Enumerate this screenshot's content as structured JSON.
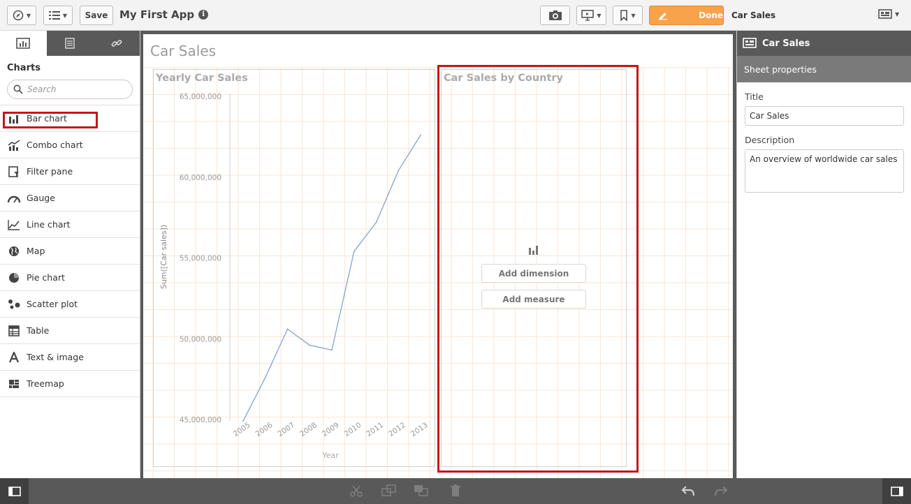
{
  "toolbar": {
    "save_label": "Save",
    "app_title": "My First App",
    "info_glyph": "i",
    "done_label": "Done",
    "sheet_name": "Car Sales"
  },
  "left_panel": {
    "heading": "Charts",
    "search_placeholder": "Search",
    "items": [
      {
        "label": "Bar chart",
        "icon": "bar-chart-icon"
      },
      {
        "label": "Combo chart",
        "icon": "combo-chart-icon"
      },
      {
        "label": "Filter pane",
        "icon": "filter-pane-icon"
      },
      {
        "label": "Gauge",
        "icon": "gauge-icon"
      },
      {
        "label": "Line chart",
        "icon": "line-chart-icon"
      },
      {
        "label": "Map",
        "icon": "map-icon"
      },
      {
        "label": "Pie chart",
        "icon": "pie-chart-icon"
      },
      {
        "label": "Scatter plot",
        "icon": "scatter-plot-icon"
      },
      {
        "label": "Table",
        "icon": "table-icon"
      },
      {
        "label": "Text & image",
        "icon": "text-image-icon"
      },
      {
        "label": "Treemap",
        "icon": "treemap-icon"
      }
    ]
  },
  "sheet": {
    "title": "Car Sales",
    "panel2": {
      "title": "Car Sales by Country",
      "add_dimension": "Add dimension",
      "add_measure": "Add measure"
    }
  },
  "chart_data": {
    "type": "line",
    "title": "Yearly Car Sales",
    "xlabel": "Year",
    "ylabel": "Sum([Car sales])",
    "x": [
      "2005",
      "2006",
      "2007",
      "2008",
      "2009",
      "2010",
      "2011",
      "2012",
      "2013"
    ],
    "series": [
      {
        "values": [
          44900000,
          47600000,
          50600000,
          49600000,
          49300000,
          55400000,
          57200000,
          60400000,
          62600000
        ]
      }
    ],
    "ylim": [
      45000000,
      65000000
    ],
    "yticks": [
      {
        "value": 45000000,
        "label": "45,000,000"
      },
      {
        "value": 50000000,
        "label": "50,000,000"
      },
      {
        "value": 55000000,
        "label": "55,000,000"
      },
      {
        "value": 60000000,
        "label": "60,000,000"
      },
      {
        "value": 65000000,
        "label": "65,000,000"
      }
    ],
    "line_color": "#7a9cc6"
  },
  "right_panel": {
    "header": "Car Sales",
    "subheader": "Sheet properties",
    "title_label": "Title",
    "title_value": "Car Sales",
    "description_label": "Description",
    "description_value": "An overview of worldwide car sales"
  },
  "colors": {
    "accent": "#f8a24b",
    "highlight": "#c4161c",
    "chrome": "#595959"
  }
}
